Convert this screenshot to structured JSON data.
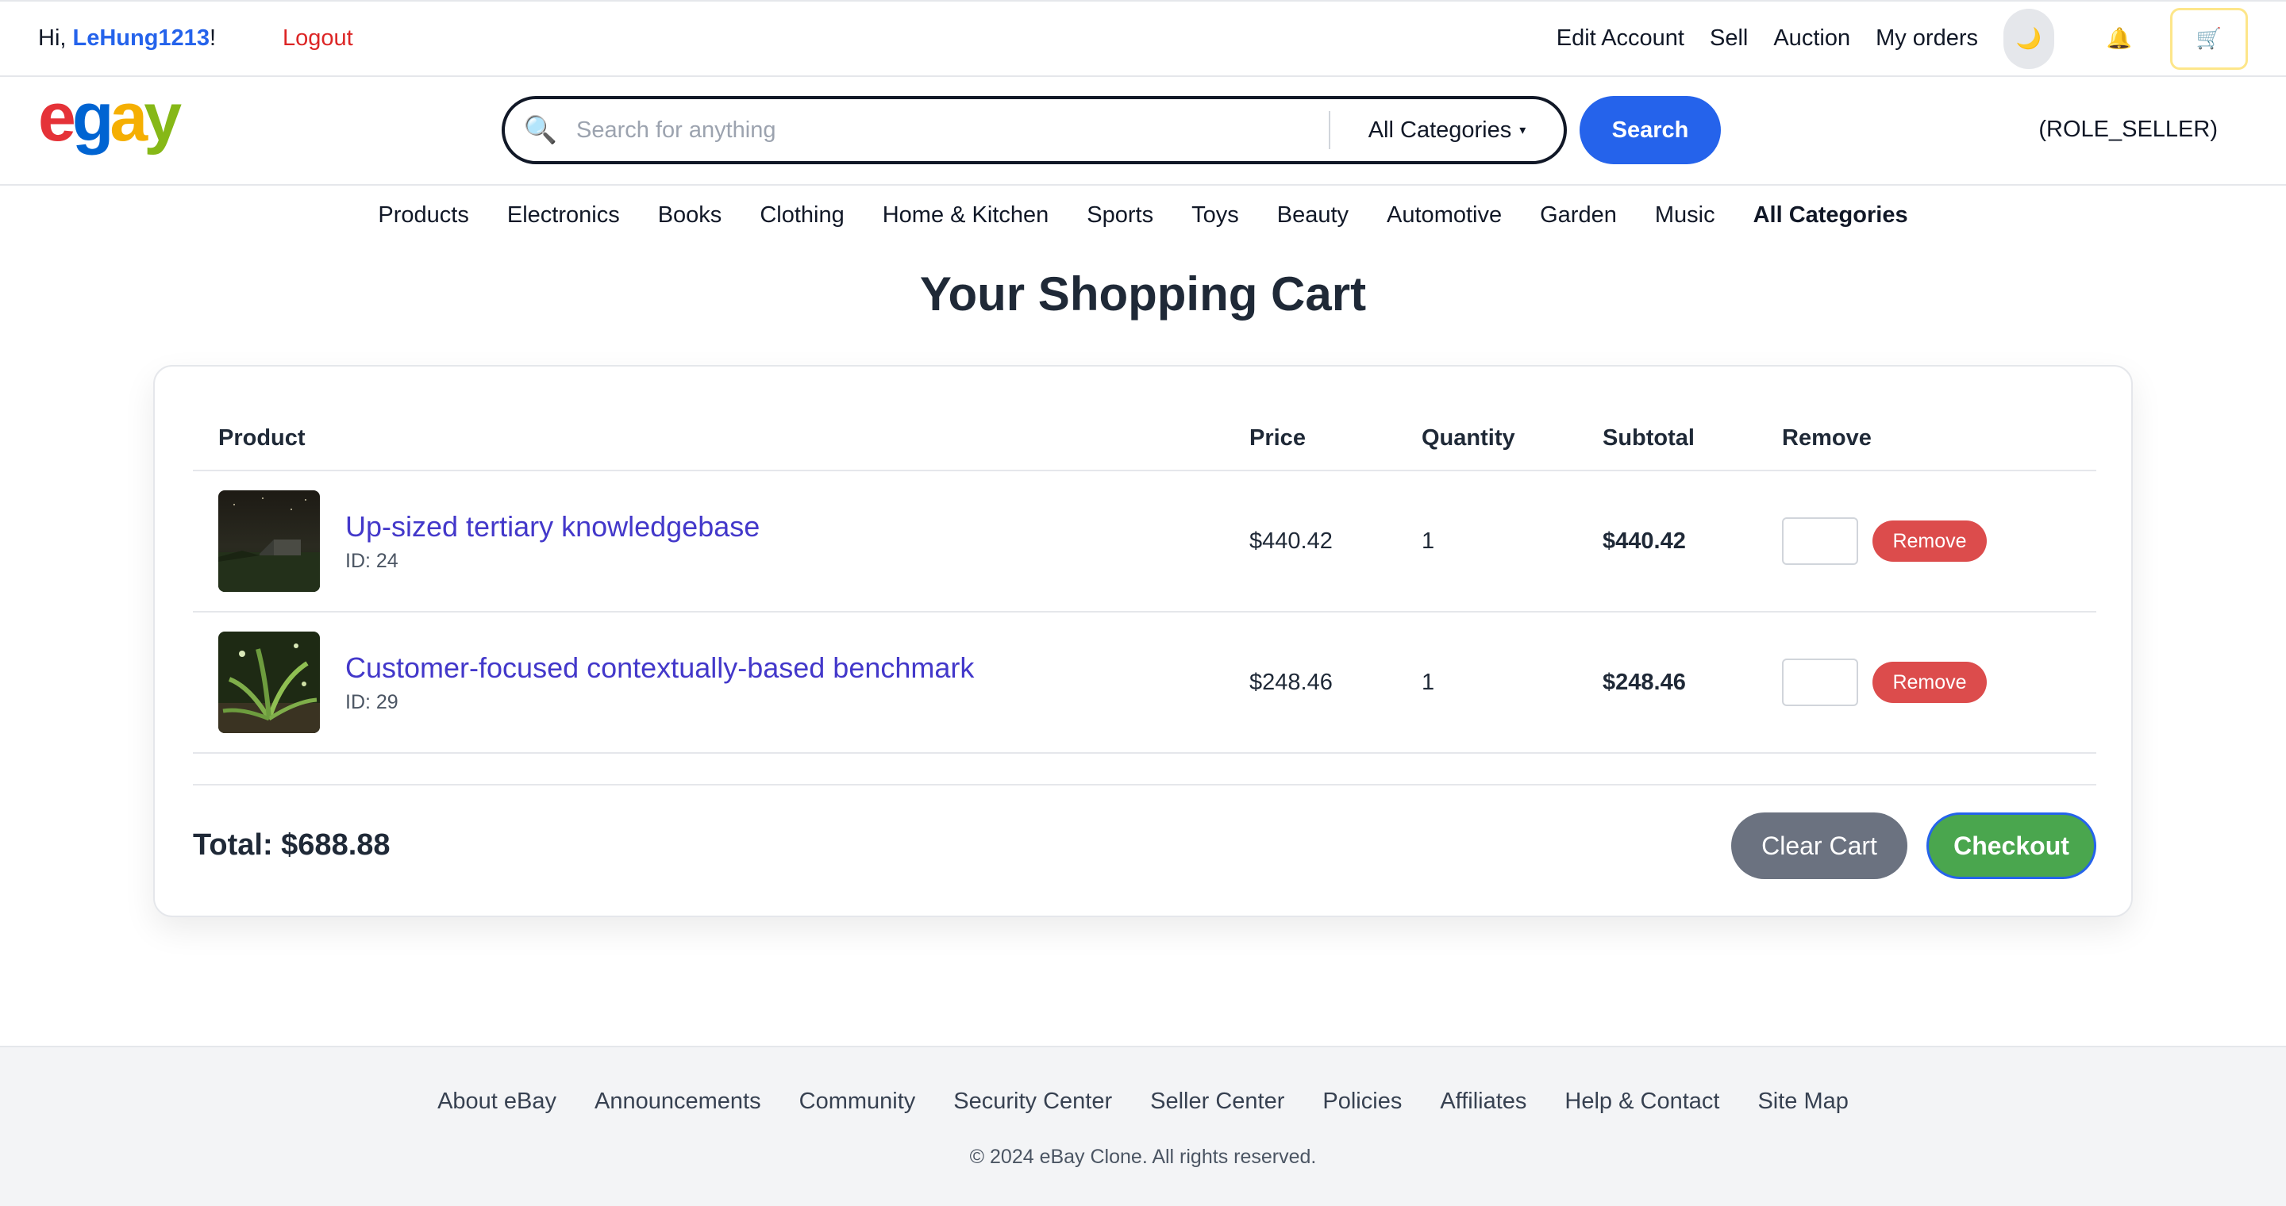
{
  "topbar": {
    "greeting_prefix": "Hi, ",
    "username": "LeHung1213",
    "greeting_suffix": "!",
    "logout": "Logout",
    "links": [
      "Edit Account",
      "Sell",
      "Auction",
      "My orders"
    ],
    "theme_icon": "🌙",
    "bell_icon": "🔔",
    "cart_icon": "🛒"
  },
  "header": {
    "logo": [
      "e",
      "g",
      "a",
      "y"
    ],
    "search_icon": "🔍",
    "search_placeholder": "Search for anything",
    "category": "All Categories",
    "category_caret": "▾",
    "search_button": "Search",
    "role": "(ROLE_SELLER)"
  },
  "nav": {
    "categories": [
      "Products",
      "Electronics",
      "Books",
      "Clothing",
      "Home & Kitchen",
      "Sports",
      "Toys",
      "Beauty",
      "Automotive",
      "Garden",
      "Music",
      "All Categories"
    ]
  },
  "cart": {
    "title": "Your Shopping Cart",
    "headers": {
      "product": "Product",
      "price": "Price",
      "quantity": "Quantity",
      "subtotal": "Subtotal",
      "remove": "Remove"
    },
    "items": [
      {
        "name": "Up-sized tertiary knowledgebase",
        "id": "ID: 24",
        "price": "$440.42",
        "quantity": "1",
        "subtotal": "$440.42",
        "remove": "Remove"
      },
      {
        "name": "Customer-focused contextually-based benchmark",
        "id": "ID: 29",
        "price": "$248.46",
        "quantity": "1",
        "subtotal": "$248.46",
        "remove": "Remove"
      }
    ],
    "total": "Total: $688.88",
    "clear_button": "Clear Cart",
    "checkout_button": "Checkout"
  },
  "footer": {
    "links": [
      "About eBay",
      "Announcements",
      "Community",
      "Security Center",
      "Seller Center",
      "Policies",
      "Affiliates",
      "Help & Contact",
      "Site Map"
    ],
    "copyright": "© 2024 eBay Clone. All rights reserved."
  },
  "colors": {
    "accent": "#2563eb",
    "danger": "#dc2626",
    "success": "#4aa64e",
    "product_link": "#4338ca"
  }
}
